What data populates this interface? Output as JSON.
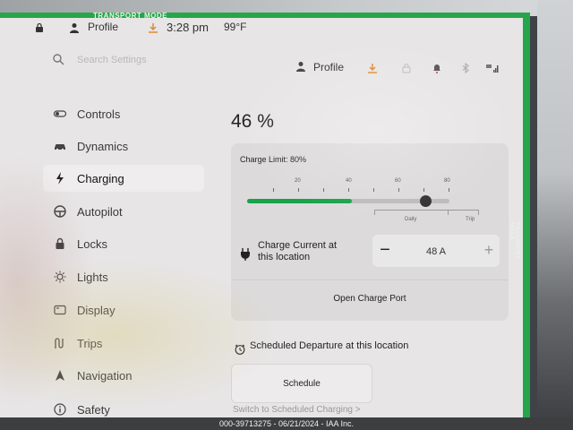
{
  "frame": {
    "label": "TRANSPORT MODE",
    "side_label": "TRANSPORT MODE",
    "color": "#26a54a"
  },
  "statusbar": {
    "profile": "Profile",
    "time": "3:28 pm",
    "temperature": "99°F"
  },
  "header": {
    "search_placeholder": "Search Settings",
    "profile": "Profile",
    "icons": [
      "person-icon",
      "download-icon",
      "lock-icon",
      "bell-icon",
      "bluetooth-icon",
      "lte-signal-icon"
    ]
  },
  "sidebar": {
    "items": [
      {
        "label": "Controls",
        "icon": "toggle-icon",
        "active": false
      },
      {
        "label": "Dynamics",
        "icon": "car-icon",
        "active": false
      },
      {
        "label": "Charging",
        "icon": "bolt-icon",
        "active": true
      },
      {
        "label": "Autopilot",
        "icon": "steering-wheel-icon",
        "active": false
      },
      {
        "label": "Locks",
        "icon": "lock-icon",
        "active": false
      },
      {
        "label": "Lights",
        "icon": "sun-icon",
        "active": false
      },
      {
        "label": "Display",
        "icon": "display-icon",
        "active": false
      },
      {
        "label": "Trips",
        "icon": "trips-icon",
        "active": false
      },
      {
        "label": "Navigation",
        "icon": "navigation-icon",
        "active": false
      },
      {
        "label": "Safety",
        "icon": "info-icon",
        "active": false
      }
    ]
  },
  "charging": {
    "battery_percent": "46 %",
    "charge_limit_label": "Charge Limit: 80%",
    "charge_limit_value": 80,
    "slider_ticks": [
      "20",
      "40",
      "60",
      "80"
    ],
    "range_labels": {
      "daily": "Daily",
      "trip": "Trip"
    },
    "accent_color": "#16a34a",
    "current_label": "Charge Current at this location",
    "current_value": "48 A",
    "minus": "−",
    "plus": "+",
    "open_port_label": "Open Charge Port"
  },
  "scheduled": {
    "title": "Scheduled Departure at this location",
    "schedule_button": "Schedule",
    "switch_link": "Switch to Scheduled Charging >"
  },
  "watermark": "000-39713275 - 06/21/2024 - IAA Inc."
}
